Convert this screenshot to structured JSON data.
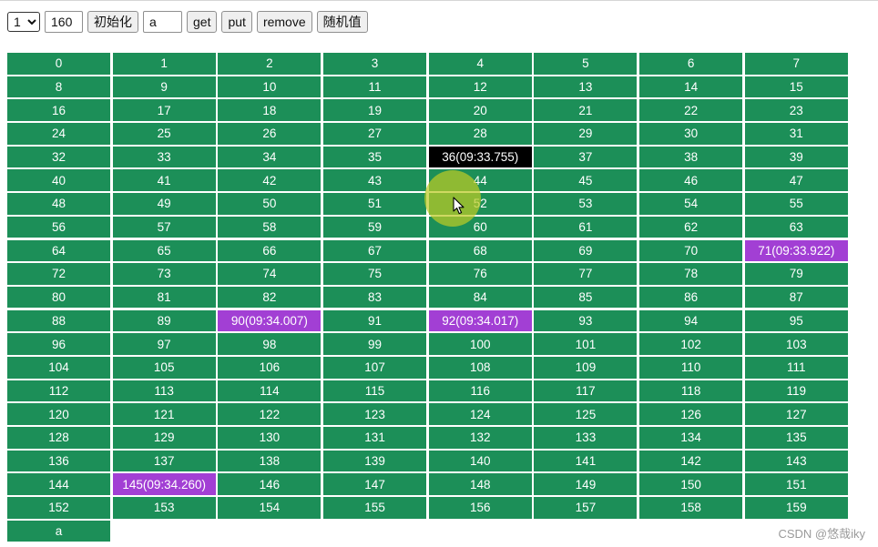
{
  "toolbar": {
    "select_value": "1",
    "select_options": [
      "1"
    ],
    "count_value": "160",
    "init_label": "初始化",
    "key_value": "a",
    "get_label": "get",
    "put_label": "put",
    "remove_label": "remove",
    "random_label": "随机值"
  },
  "colors": {
    "cell_default": "#1c8f58",
    "cell_active": "#000000",
    "cell_recent": "#a23fd4",
    "cell_text": "#ffffff"
  },
  "grid": {
    "cells": [
      {
        "label": "0"
      },
      {
        "label": "1"
      },
      {
        "label": "2"
      },
      {
        "label": "3"
      },
      {
        "label": "4"
      },
      {
        "label": "5"
      },
      {
        "label": "6"
      },
      {
        "label": "7"
      },
      {
        "label": "8"
      },
      {
        "label": "9"
      },
      {
        "label": "10"
      },
      {
        "label": "11"
      },
      {
        "label": "12"
      },
      {
        "label": "13"
      },
      {
        "label": "14"
      },
      {
        "label": "15"
      },
      {
        "label": "16"
      },
      {
        "label": "17"
      },
      {
        "label": "18"
      },
      {
        "label": "19"
      },
      {
        "label": "20"
      },
      {
        "label": "21"
      },
      {
        "label": "22"
      },
      {
        "label": "23"
      },
      {
        "label": "24"
      },
      {
        "label": "25"
      },
      {
        "label": "26"
      },
      {
        "label": "27"
      },
      {
        "label": "28"
      },
      {
        "label": "29"
      },
      {
        "label": "30"
      },
      {
        "label": "31"
      },
      {
        "label": "32"
      },
      {
        "label": "33"
      },
      {
        "label": "34"
      },
      {
        "label": "35"
      },
      {
        "label": "36(09:33.755)",
        "state": "active"
      },
      {
        "label": "37"
      },
      {
        "label": "38"
      },
      {
        "label": "39"
      },
      {
        "label": "40"
      },
      {
        "label": "41"
      },
      {
        "label": "42"
      },
      {
        "label": "43"
      },
      {
        "label": "44"
      },
      {
        "label": "45"
      },
      {
        "label": "46"
      },
      {
        "label": "47"
      },
      {
        "label": "48"
      },
      {
        "label": "49"
      },
      {
        "label": "50"
      },
      {
        "label": "51"
      },
      {
        "label": "52"
      },
      {
        "label": "53"
      },
      {
        "label": "54"
      },
      {
        "label": "55"
      },
      {
        "label": "56"
      },
      {
        "label": "57"
      },
      {
        "label": "58"
      },
      {
        "label": "59"
      },
      {
        "label": "60"
      },
      {
        "label": "61"
      },
      {
        "label": "62"
      },
      {
        "label": "63"
      },
      {
        "label": "64"
      },
      {
        "label": "65"
      },
      {
        "label": "66"
      },
      {
        "label": "67"
      },
      {
        "label": "68"
      },
      {
        "label": "69"
      },
      {
        "label": "70"
      },
      {
        "label": "71(09:33.922)",
        "state": "recent"
      },
      {
        "label": "72"
      },
      {
        "label": "73"
      },
      {
        "label": "74"
      },
      {
        "label": "75"
      },
      {
        "label": "76"
      },
      {
        "label": "77"
      },
      {
        "label": "78"
      },
      {
        "label": "79"
      },
      {
        "label": "80"
      },
      {
        "label": "81"
      },
      {
        "label": "82"
      },
      {
        "label": "83"
      },
      {
        "label": "84"
      },
      {
        "label": "85"
      },
      {
        "label": "86"
      },
      {
        "label": "87"
      },
      {
        "label": "88"
      },
      {
        "label": "89"
      },
      {
        "label": "90(09:34.007)",
        "state": "recent"
      },
      {
        "label": "91"
      },
      {
        "label": "92(09:34.017)",
        "state": "recent"
      },
      {
        "label": "93"
      },
      {
        "label": "94"
      },
      {
        "label": "95"
      },
      {
        "label": "96"
      },
      {
        "label": "97"
      },
      {
        "label": "98"
      },
      {
        "label": "99"
      },
      {
        "label": "100"
      },
      {
        "label": "101"
      },
      {
        "label": "102"
      },
      {
        "label": "103"
      },
      {
        "label": "104"
      },
      {
        "label": "105"
      },
      {
        "label": "106"
      },
      {
        "label": "107"
      },
      {
        "label": "108"
      },
      {
        "label": "109"
      },
      {
        "label": "110"
      },
      {
        "label": "111"
      },
      {
        "label": "112"
      },
      {
        "label": "113"
      },
      {
        "label": "114"
      },
      {
        "label": "115"
      },
      {
        "label": "116"
      },
      {
        "label": "117"
      },
      {
        "label": "118"
      },
      {
        "label": "119"
      },
      {
        "label": "120"
      },
      {
        "label": "121"
      },
      {
        "label": "122"
      },
      {
        "label": "123"
      },
      {
        "label": "124"
      },
      {
        "label": "125"
      },
      {
        "label": "126"
      },
      {
        "label": "127"
      },
      {
        "label": "128"
      },
      {
        "label": "129"
      },
      {
        "label": "130"
      },
      {
        "label": "131"
      },
      {
        "label": "132"
      },
      {
        "label": "133"
      },
      {
        "label": "134"
      },
      {
        "label": "135"
      },
      {
        "label": "136"
      },
      {
        "label": "137"
      },
      {
        "label": "138"
      },
      {
        "label": "139"
      },
      {
        "label": "140"
      },
      {
        "label": "141"
      },
      {
        "label": "142"
      },
      {
        "label": "143"
      },
      {
        "label": "144"
      },
      {
        "label": "145(09:34.260)",
        "state": "recent"
      },
      {
        "label": "146"
      },
      {
        "label": "147"
      },
      {
        "label": "148"
      },
      {
        "label": "149"
      },
      {
        "label": "150"
      },
      {
        "label": "151"
      },
      {
        "label": "152"
      },
      {
        "label": "153"
      },
      {
        "label": "154"
      },
      {
        "label": "155"
      },
      {
        "label": "156"
      },
      {
        "label": "157"
      },
      {
        "label": "158"
      },
      {
        "label": "159"
      },
      {
        "label": "a"
      }
    ]
  },
  "cursor": {
    "icon": "mouse-pointer-icon",
    "halo_icon": "cursor-highlight-icon"
  },
  "watermark": "CSDN @悠哉iky"
}
